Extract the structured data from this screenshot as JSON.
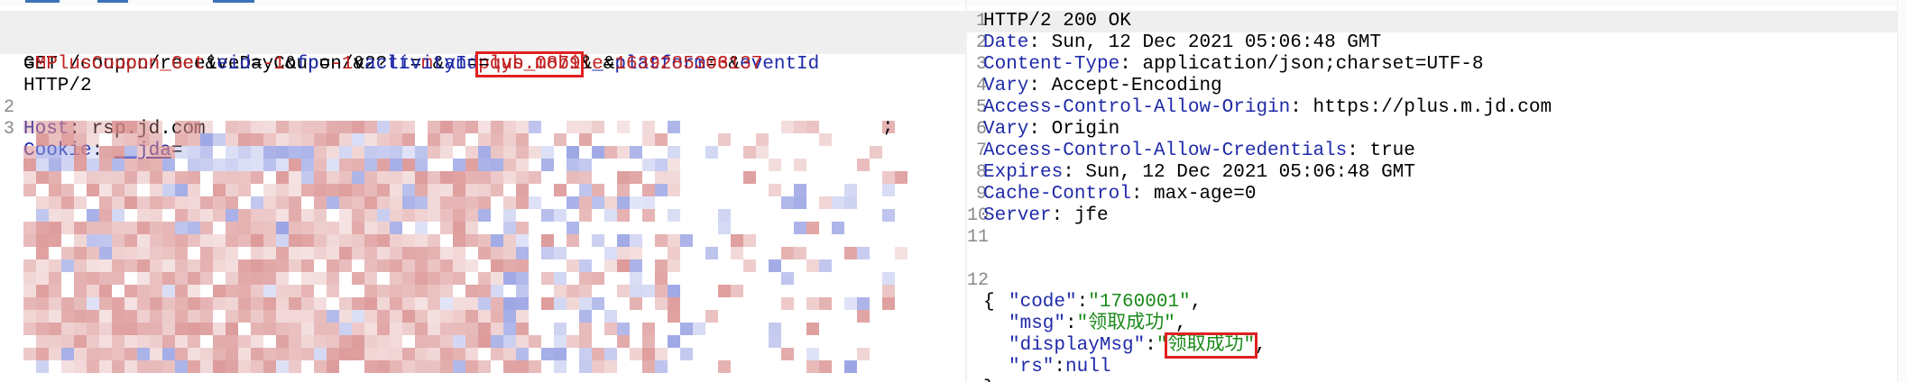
{
  "request": {
    "line1": {
      "num": "1",
      "method_path": "GET /coupon/receiveDayCoupon/v2?",
      "p1_key": "lt",
      "eq": "=",
      "amp": "&",
      "p1_val": "m",
      "p2_key": "an",
      "p2_val": "plus.mobile",
      "p3_key": "platform",
      "p3_val": "3",
      "p4_key": "eventId"
    },
    "line1b": {
      "eq": "=",
      "p4_val": "MPlusCoupon_Get",
      "amp": "&",
      "p5_key": "eid",
      "p5_val": "-1",
      "p6_key": "fp",
      "p6_val": "-1",
      "p7_key": "activityId",
      "p7_val": "qyb_0879",
      "p8_key": "_",
      "p8_val": "1639285306137"
    },
    "line1c": "HTTP/2",
    "line2": {
      "num": "2",
      "key": "Host",
      "value": ": rsp.jd.com"
    },
    "line3": {
      "num": "3",
      "key": "Cookie",
      "colon": ": ",
      "cookie_name": "__jda",
      "eq": "="
    },
    "semicolon": ";"
  },
  "response": {
    "lines": [
      {
        "num": "1",
        "key": "",
        "value": "HTTP/2 200 OK"
      },
      {
        "num": "2",
        "key": "Date",
        "value": ": Sun, 12 Dec 2021 05:06:48 GMT"
      },
      {
        "num": "3",
        "key": "Content-Type",
        "value": ": application/json;charset=UTF-8"
      },
      {
        "num": "4",
        "key": "Vary",
        "value": ": Accept-Encoding"
      },
      {
        "num": "5",
        "key": "Access-Control-Allow-Origin",
        "value": ": https://plus.m.jd.com"
      },
      {
        "num": "6",
        "key": "Vary",
        "value": ": Origin"
      },
      {
        "num": "7",
        "key": "Access-Control-Allow-Credentials",
        "value": ": true"
      },
      {
        "num": "8",
        "key": "Expires",
        "value": ": Sun, 12 Dec 2021 05:06:48 GMT"
      },
      {
        "num": "9",
        "key": "Cache-Control",
        "value": ": max-age=0"
      },
      {
        "num": "10",
        "key": "Server",
        "value": ": jfe"
      },
      {
        "num": "11",
        "key": "",
        "value": ""
      }
    ],
    "json_open": {
      "num": "12",
      "text": "{"
    },
    "json": {
      "code_key": "\"code\"",
      "code_val": "\"1760001\"",
      "msg_key": "\"msg\"",
      "msg_val": "\"领取成功\"",
      "display_key": "\"displayMsg\"",
      "display_q": "\"",
      "display_val": "领取成功\"",
      "rs_key": "\"rs\"",
      "rs_val": "null",
      "colon": ":",
      "comma": ",",
      "close": "}"
    }
  },
  "colors": {
    "redacted_red": "#d88a8a",
    "redacted_blue": "#8c97e0",
    "highlight_box": "#e02020"
  }
}
